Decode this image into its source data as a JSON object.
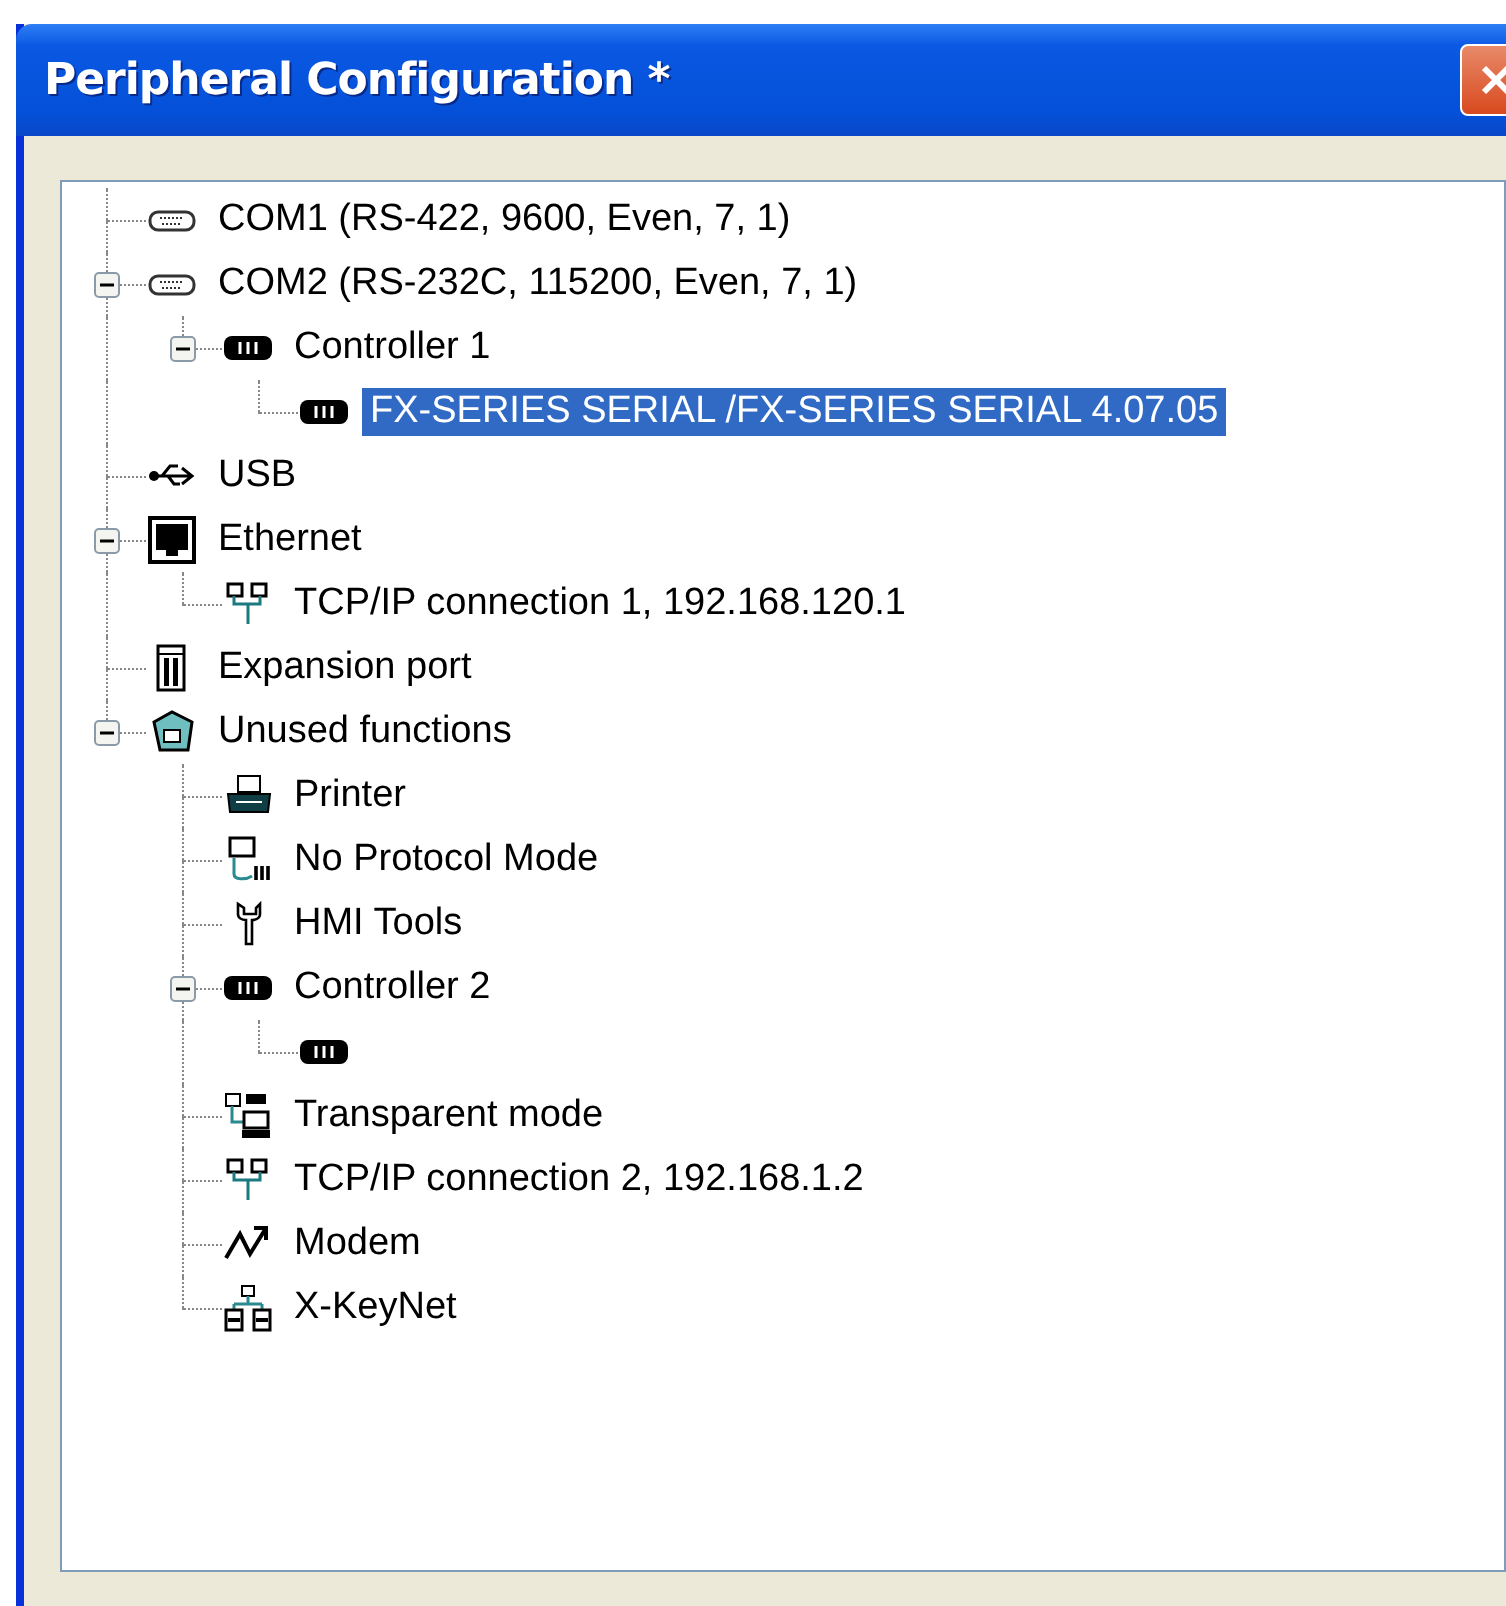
{
  "window": {
    "title": "Peripheral Configuration *"
  },
  "tree": [
    {
      "label": "COM1  (RS-422, 9600, Even, 7, 1)",
      "kind": "port",
      "selected": false
    },
    {
      "label": "COM2  (RS-232C, 115200, Even, 7, 1)",
      "kind": "port",
      "selected": false,
      "expanded": true,
      "children": [
        {
          "label": "Controller 1",
          "kind": "controller",
          "selected": false,
          "expanded": true,
          "children": [
            {
              "label": "FX-SERIES SERIAL /FX-SERIES SERIAL  4.07.05",
              "kind": "controller",
              "selected": true
            }
          ]
        }
      ]
    },
    {
      "label": "USB",
      "kind": "usb",
      "selected": false
    },
    {
      "label": "Ethernet",
      "kind": "ethernet",
      "selected": false,
      "expanded": true,
      "children": [
        {
          "label": "TCP/IP connection 1, 192.168.120.1",
          "kind": "network",
          "selected": false
        }
      ]
    },
    {
      "label": "Expansion port",
      "kind": "expansion",
      "selected": false
    },
    {
      "label": "Unused functions",
      "kind": "unused",
      "selected": false,
      "expanded": true,
      "children": [
        {
          "label": "Printer",
          "kind": "printer",
          "selected": false
        },
        {
          "label": "No Protocol Mode",
          "kind": "protocol",
          "selected": false
        },
        {
          "label": "HMI Tools",
          "kind": "tools",
          "selected": false
        },
        {
          "label": "Controller 2",
          "kind": "controller",
          "selected": false,
          "expanded": true,
          "children": [
            {
              "kind": "controller",
              "selected": false
            }
          ]
        },
        {
          "label": "Transparent mode",
          "kind": "transparent",
          "selected": false
        },
        {
          "label": "TCP/IP connection 2, 192.168.1.2",
          "kind": "network",
          "selected": false
        },
        {
          "label": "Modem",
          "kind": "modem",
          "selected": false
        },
        {
          "label": "X-KeyNet",
          "kind": "xkeynet",
          "selected": false
        }
      ]
    }
  ]
}
